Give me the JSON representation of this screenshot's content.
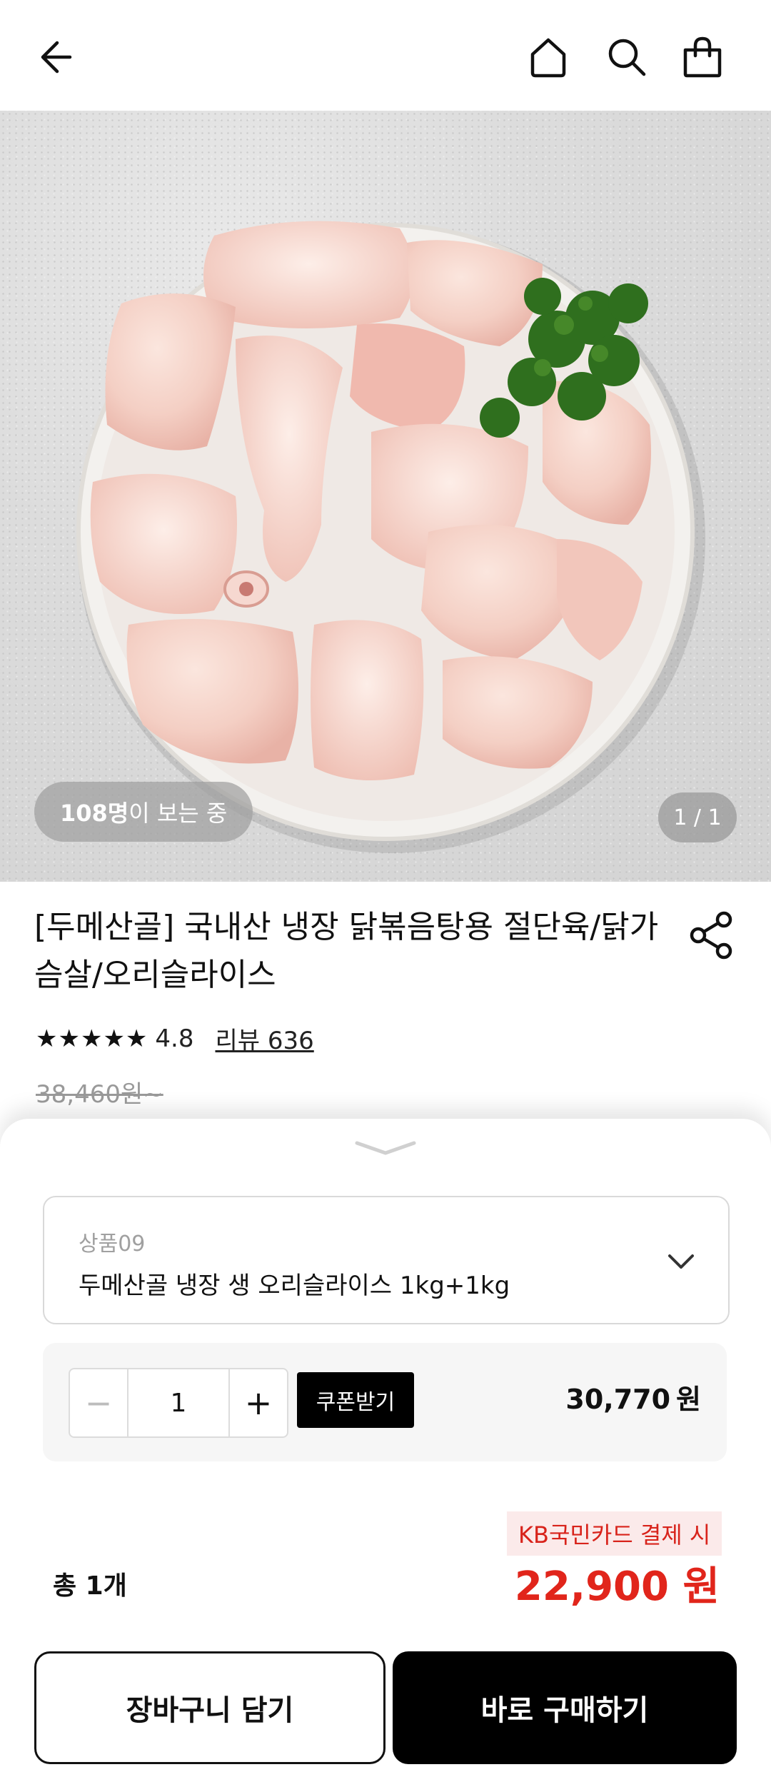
{
  "header": {
    "icons": [
      "back-arrow-icon",
      "home-icon",
      "search-icon",
      "shopping-bag-icon"
    ]
  },
  "hero": {
    "viewers_count": "108명",
    "viewers_text": "이 보는 중",
    "pager": "1 / 1"
  },
  "product": {
    "title": "[두메산골] 국내산 냉장 닭볶음탕용 절단육/닭가슴살/오리슬라이스",
    "stars": "★★★★★",
    "rating": "4.8",
    "reviews": "리뷰 636",
    "original_price": "38,460원~"
  },
  "option": {
    "label": "상품09",
    "value": "두메산골 냉장 생 오리슬라이스 1kg+1kg"
  },
  "quantity": {
    "minus": "−",
    "value": "1",
    "plus": "+",
    "coupon": "쿠폰받기",
    "price": "30,770",
    "currency": "원"
  },
  "summary": {
    "kb_label": "KB국민카드 결제 시",
    "total_label": "총 1개",
    "final_price": "22,900 원"
  },
  "buttons": {
    "cart": "장바구니 담기",
    "buy": "바로 구매하기"
  },
  "colors": {
    "accent_red": "#e1251b",
    "black": "#000000"
  }
}
